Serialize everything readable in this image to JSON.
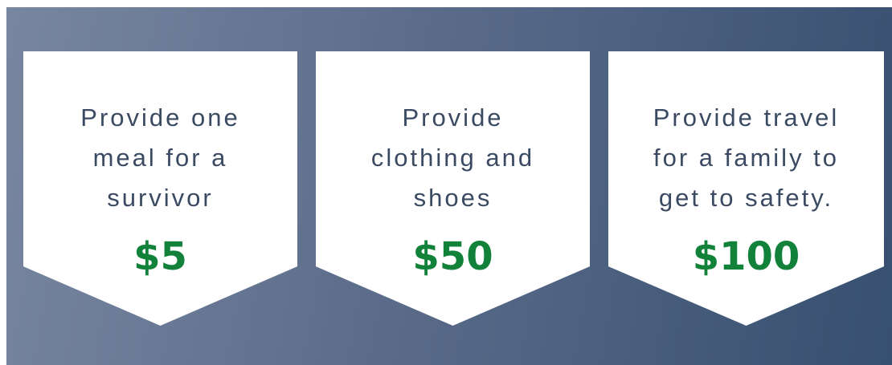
{
  "cards": [
    {
      "text": "Provide one\nmeal for a\nsurvivor",
      "amount": "$5"
    },
    {
      "text": "Provide\nclothing and\nshoes",
      "amount": "$50"
    },
    {
      "text": "Provide travel\nfor a family to\nget to safety.",
      "amount": "$100"
    }
  ],
  "colors": {
    "background_start": "#7886a0",
    "background_end": "#374f71",
    "card": "#ffffff",
    "text": "#3b4a63",
    "amount": "#12823a"
  }
}
